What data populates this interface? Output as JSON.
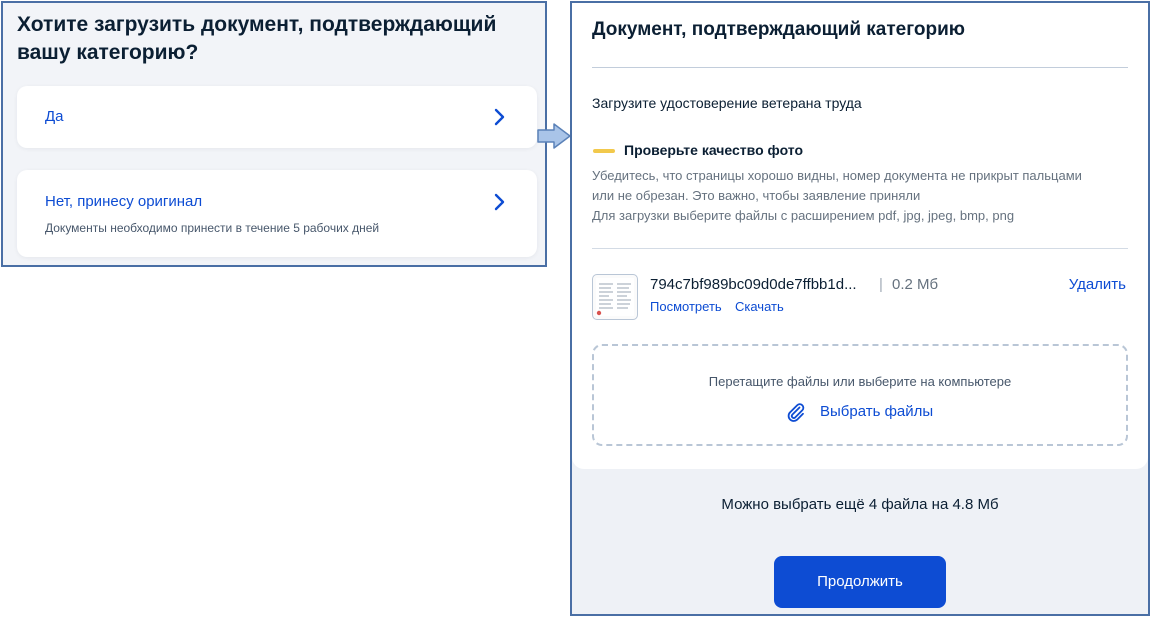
{
  "category_question": {
    "title": "Хотите загрузить документ, подтверждающий вашу категорию?",
    "options": [
      {
        "label": "Да",
        "hint": ""
      },
      {
        "label": "Нет, принесу оригинал",
        "hint": "Документы необходимо принести в течение 5 рабочих дней"
      }
    ]
  },
  "document_upload": {
    "title": "Документ, подтверждающий категорию",
    "subtitle": "Загрузите удостоверение ветерана труда",
    "quality": {
      "title": "Проверьте качество фото",
      "lines": [
        "Убедитесь, что страницы хорошо видны, номер документа не прикрыт пальцами",
        "или не обрезан. Это важно, чтобы заявление приняли",
        "Для загрузки выберите файлы с расширением pdf, jpg, jpeg, bmp, png"
      ]
    },
    "file": {
      "name": "794c7bf989bc09d0de7ffbb1d...",
      "separator": "|",
      "size": "0.2 Мб",
      "delete_label": "Удалить",
      "view_label": "Посмотреть",
      "download_label": "Скачать"
    },
    "dropzone": {
      "hint": "Перетащите файлы или выберите на компьютере",
      "choose_label": "Выбрать файлы"
    },
    "remaining": "Можно выбрать ещё 4 файла на 4.8 Мб",
    "continue_label": "Продолжить"
  },
  "colors": {
    "accent": "#0d4cd3",
    "warning_mark": "#f2c94c",
    "panel_border": "#4a6fa5"
  }
}
